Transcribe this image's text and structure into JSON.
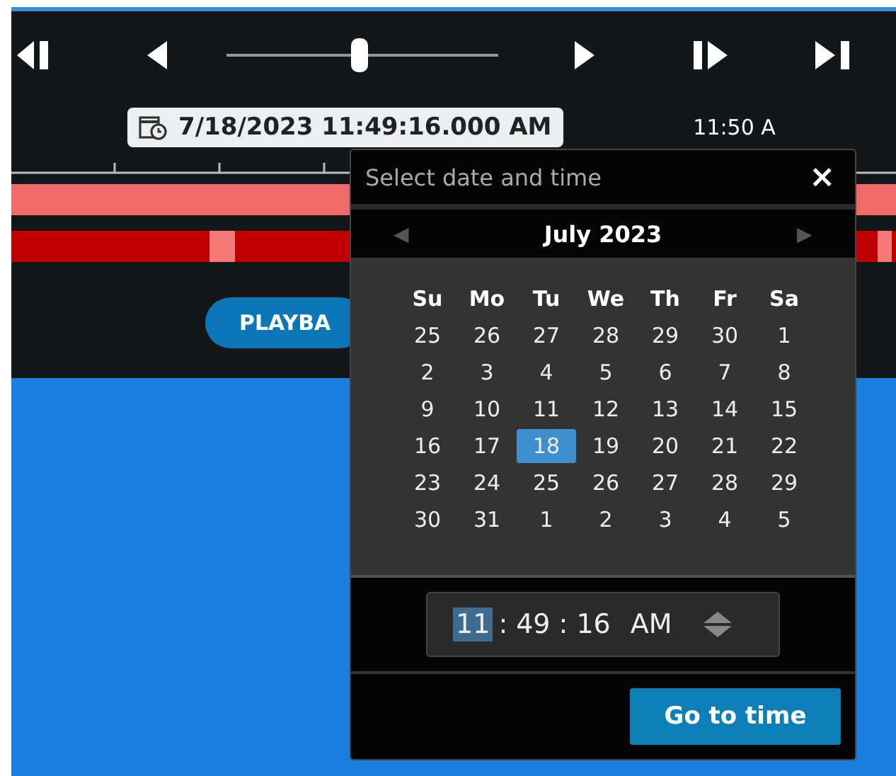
{
  "transport": {
    "slider": {
      "level": 0.49
    }
  },
  "timeline": {
    "current_time": "7/18/2023 11:49:16.000 AM",
    "next_label": "11:50 A"
  },
  "playback_button": {
    "label": "PLAYBA"
  },
  "dialog": {
    "title": "Select date and time",
    "close": "×",
    "month": "July 2023",
    "prev": "◀",
    "next": "▶",
    "weekdays": [
      "Su",
      "Mo",
      "Tu",
      "We",
      "Th",
      "Fr",
      "Sa"
    ],
    "days": [
      {
        "label": "25",
        "selected": false
      },
      {
        "label": "26",
        "selected": false
      },
      {
        "label": "27",
        "selected": false
      },
      {
        "label": "28",
        "selected": false
      },
      {
        "label": "29",
        "selected": false
      },
      {
        "label": "30",
        "selected": false
      },
      {
        "label": "1",
        "selected": false
      },
      {
        "label": "2",
        "selected": false
      },
      {
        "label": "3",
        "selected": false
      },
      {
        "label": "4",
        "selected": false
      },
      {
        "label": "5",
        "selected": false
      },
      {
        "label": "6",
        "selected": false
      },
      {
        "label": "7",
        "selected": false
      },
      {
        "label": "8",
        "selected": false
      },
      {
        "label": "9",
        "selected": false
      },
      {
        "label": "10",
        "selected": false
      },
      {
        "label": "11",
        "selected": false
      },
      {
        "label": "12",
        "selected": false
      },
      {
        "label": "13",
        "selected": false
      },
      {
        "label": "14",
        "selected": false
      },
      {
        "label": "15",
        "selected": false
      },
      {
        "label": "16",
        "selected": false
      },
      {
        "label": "17",
        "selected": false
      },
      {
        "label": "18",
        "selected": true
      },
      {
        "label": "19",
        "selected": false
      },
      {
        "label": "20",
        "selected": false
      },
      {
        "label": "21",
        "selected": false
      },
      {
        "label": "22",
        "selected": false
      },
      {
        "label": "23",
        "selected": false
      },
      {
        "label": "24",
        "selected": false
      },
      {
        "label": "25",
        "selected": false
      },
      {
        "label": "26",
        "selected": false
      },
      {
        "label": "27",
        "selected": false
      },
      {
        "label": "28",
        "selected": false
      },
      {
        "label": "29",
        "selected": false
      },
      {
        "label": "30",
        "selected": false
      },
      {
        "label": "31",
        "selected": false
      },
      {
        "label": "1",
        "selected": false
      },
      {
        "label": "2",
        "selected": false
      },
      {
        "label": "3",
        "selected": false
      },
      {
        "label": "4",
        "selected": false
      },
      {
        "label": "5",
        "selected": false
      }
    ],
    "time": [
      {
        "kind": "segment",
        "text": "11",
        "selected": true
      },
      {
        "kind": "separator",
        "text": ":"
      },
      {
        "kind": "segment",
        "text": "49",
        "selected": false
      },
      {
        "kind": "separator",
        "text": ":"
      },
      {
        "kind": "segment",
        "text": "16",
        "selected": false
      },
      {
        "kind": "segment",
        "text": "AM",
        "selected": false
      }
    ],
    "go_button": "Go to time"
  }
}
